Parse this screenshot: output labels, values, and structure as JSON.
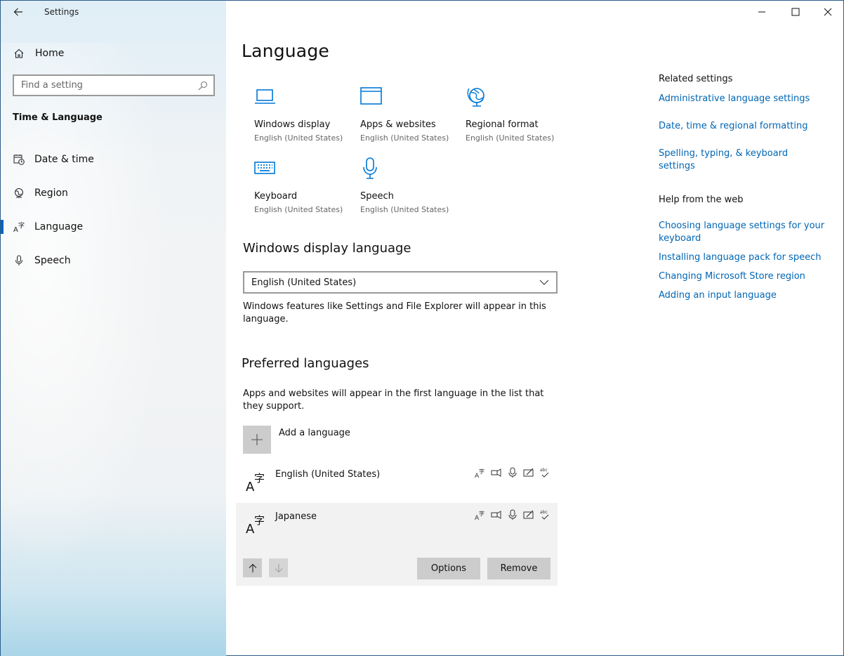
{
  "window": {
    "title": "Settings"
  },
  "sidebar": {
    "home_label": "Home",
    "search_placeholder": "Find a setting",
    "section": "Time & Language",
    "items": [
      {
        "label": "Date & time",
        "icon": "calendar-clock-icon"
      },
      {
        "label": "Region",
        "icon": "globe-icon"
      },
      {
        "label": "Language",
        "icon": "language-icon",
        "active": true
      },
      {
        "label": "Speech",
        "icon": "microphone-icon"
      }
    ]
  },
  "main": {
    "title": "Language",
    "tiles": [
      {
        "label": "Windows display",
        "sub": "English (United States)",
        "icon": "laptop-icon"
      },
      {
        "label": "Apps & websites",
        "sub": "English (United States)",
        "icon": "browser-window-icon"
      },
      {
        "label": "Regional format",
        "sub": "English (United States)",
        "icon": "regional-globe-icon"
      },
      {
        "label": "Keyboard",
        "sub": "English (United States)",
        "icon": "keyboard-icon"
      },
      {
        "label": "Speech",
        "sub": "English (United States)",
        "icon": "microphone-icon"
      }
    ],
    "display_language": {
      "heading": "Windows display language",
      "selected": "English (United States)",
      "description": "Windows features like Settings and File Explorer will appear in this language."
    },
    "preferred": {
      "heading": "Preferred languages",
      "description": "Apps and websites will appear in the first language in the list that they support.",
      "add_label": "Add a language",
      "languages": [
        {
          "name": "English (United States)"
        },
        {
          "name": "Japanese"
        }
      ],
      "options_label": "Options",
      "remove_label": "Remove"
    }
  },
  "related": {
    "title": "Related settings",
    "links": [
      "Administrative language settings",
      "Date, time & regional formatting",
      "Spelling, typing, & keyboard settings"
    ]
  },
  "help": {
    "title": "Help from the web",
    "links": [
      "Choosing language settings for your keyboard",
      "Installing language pack for speech",
      "Changing Microsoft Store region",
      "Adding an input language"
    ]
  },
  "colors": {
    "accent": "#0067c0",
    "link": "#0066b4",
    "tile_icon": "#0078d7"
  }
}
